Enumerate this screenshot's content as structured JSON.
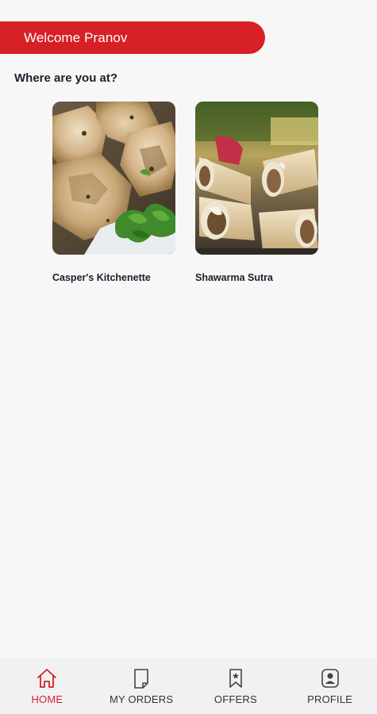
{
  "header": {
    "welcome_text": "Welcome Pranov"
  },
  "main": {
    "section_title": "Where are you at?",
    "restaurants": [
      {
        "name": "Casper's Kitchenette",
        "image": "grilled-chicken-image"
      },
      {
        "name": "Shawarma Sutra",
        "image": "shawarma-rolls-image"
      }
    ]
  },
  "bottom_nav": {
    "items": [
      {
        "label": "HOME",
        "icon": "home-icon",
        "active": true
      },
      {
        "label": "MY ORDERS",
        "icon": "orders-icon",
        "active": false
      },
      {
        "label": "OFFERS",
        "icon": "bookmark-icon",
        "active": false
      },
      {
        "label": "PROFILE",
        "icon": "profile-icon",
        "active": false
      }
    ]
  },
  "colors": {
    "accent": "#d71f26",
    "background": "#f7f7f8",
    "nav_background": "#f1f1f3",
    "text_dark": "#1c1f2a"
  }
}
